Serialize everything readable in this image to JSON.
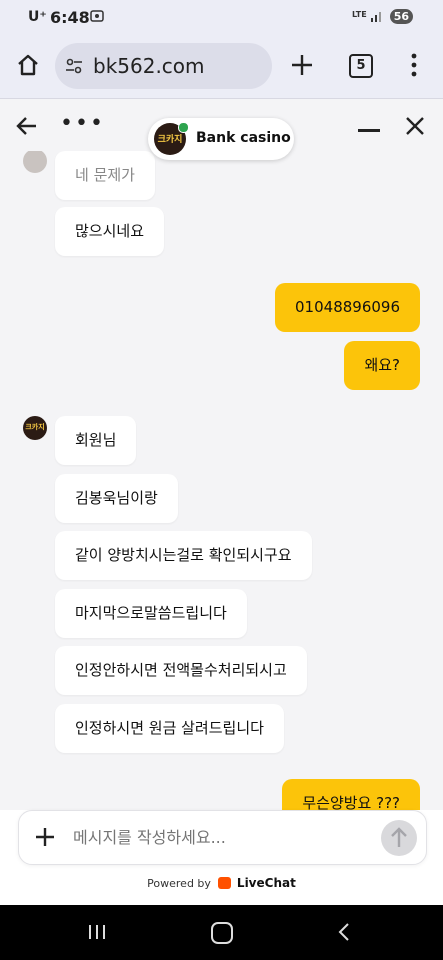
{
  "status_bar": {
    "carrier": "U⁺",
    "time": "6:48",
    "network": "LTE",
    "battery": "56"
  },
  "browser": {
    "url": "bk562.com",
    "tab_count": "5"
  },
  "chat_header": {
    "more_label": "•••",
    "agent_name": "Bank casino",
    "avatar_text": "크카지"
  },
  "messages": [
    {
      "from": "agent",
      "text": "네 문제가"
    },
    {
      "from": "agent",
      "text": "많으시네요"
    },
    {
      "from": "user",
      "text": "01048896096"
    },
    {
      "from": "user",
      "text": "왜요?"
    },
    {
      "from": "agent",
      "text": "회원님"
    },
    {
      "from": "agent",
      "text": "김봉욱님이랑"
    },
    {
      "from": "agent",
      "text": "같이 양방치시는걸로 확인되시구요"
    },
    {
      "from": "agent",
      "text": "마지막으로말씀드립니다"
    },
    {
      "from": "agent",
      "text": "인정안하시면 전액몰수처리되시고"
    },
    {
      "from": "agent",
      "text": "인정하시면 원금 살려드립니다"
    },
    {
      "from": "user",
      "text": "무슨양방요 ???"
    }
  ],
  "composer": {
    "placeholder": "메시지를 작성하세요..."
  },
  "footer": {
    "powered_by": "Powered by",
    "brand": "LiveChat"
  },
  "colors": {
    "user_bubble": "#fcc40a",
    "agent_bubble": "#ffffff",
    "chat_background": "#f4f4f6"
  }
}
